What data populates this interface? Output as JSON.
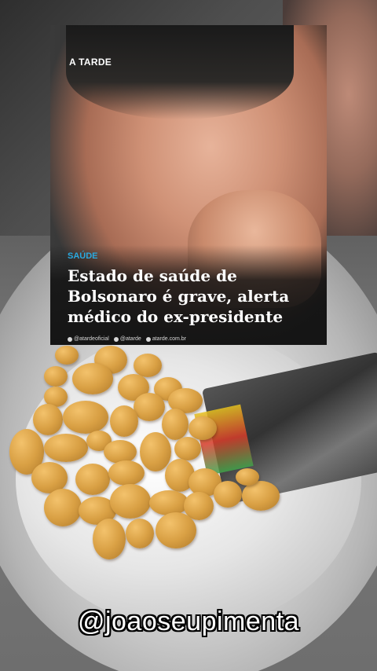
{
  "news_card": {
    "brand": "A TARDE",
    "category": "SAÚDE",
    "headline": "Estado de saúde de Bolsonaro é grave, alerta médico do ex-presidente",
    "social": [
      {
        "icon": "instagram-icon",
        "handle": "@atardeoficial"
      },
      {
        "icon": "facebook-icon",
        "handle": "@atarde"
      },
      {
        "icon": "globe-icon",
        "handle": "atarde.com.br"
      }
    ],
    "accent_color": "#29a9e0"
  },
  "overlay": {
    "watermark": "@joaoseupimenta"
  }
}
